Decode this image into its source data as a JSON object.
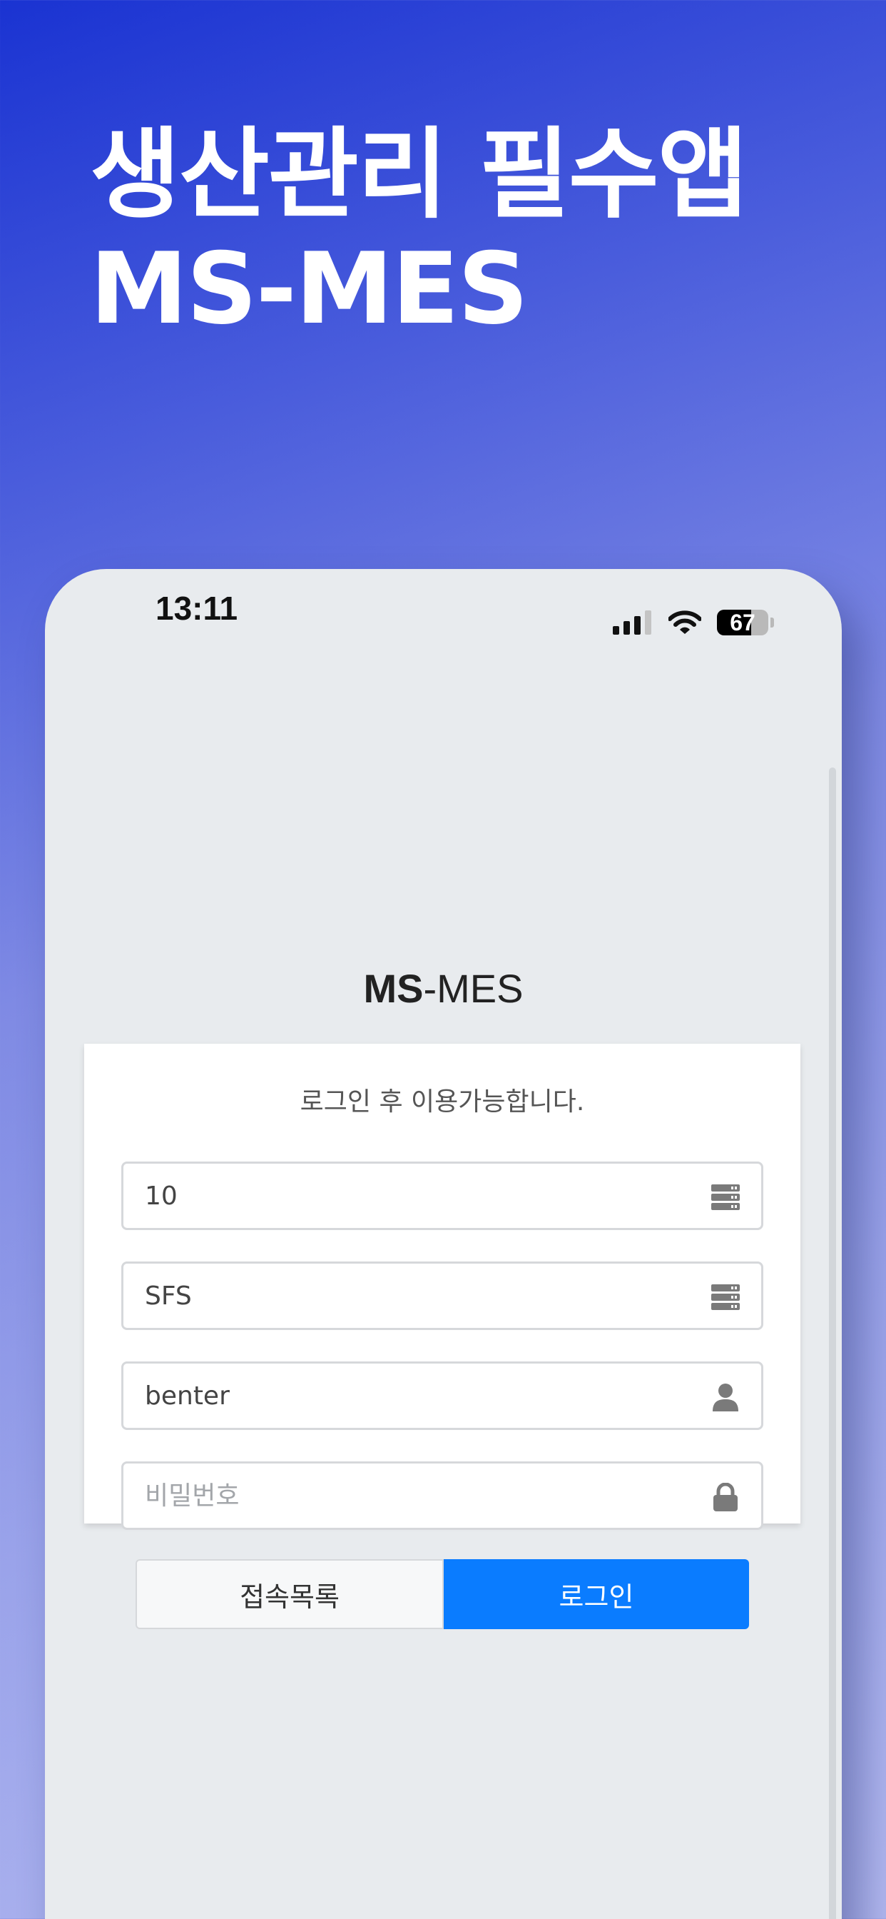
{
  "promo": {
    "headline_line1": "생산관리 필수앱",
    "headline_line2": "MS-MES"
  },
  "status_bar": {
    "time": "13:11",
    "battery_level": "67",
    "battery_fraction": 0.67,
    "icons": [
      "signal-icon",
      "wifi-icon",
      "battery-icon"
    ]
  },
  "app": {
    "title_bold": "MS",
    "title_rest": "-MES"
  },
  "login_form": {
    "notice": "로그인 후 이용가능합니다.",
    "fields": [
      {
        "value": "10",
        "icon": "server-icon"
      },
      {
        "value": "SFS",
        "icon": "server-icon"
      },
      {
        "value": "benter",
        "icon": "user-icon"
      },
      {
        "value": "",
        "placeholder": "비밀번호",
        "icon": "lock-icon"
      }
    ],
    "connection_list_label": "접속목록",
    "login_label": "로그인"
  },
  "colors": {
    "primary_button": "#0a7cff",
    "screen_background": "#e8ebee",
    "gradient_top": "#1a33d2",
    "gradient_bottom": "#b3b9f0"
  }
}
